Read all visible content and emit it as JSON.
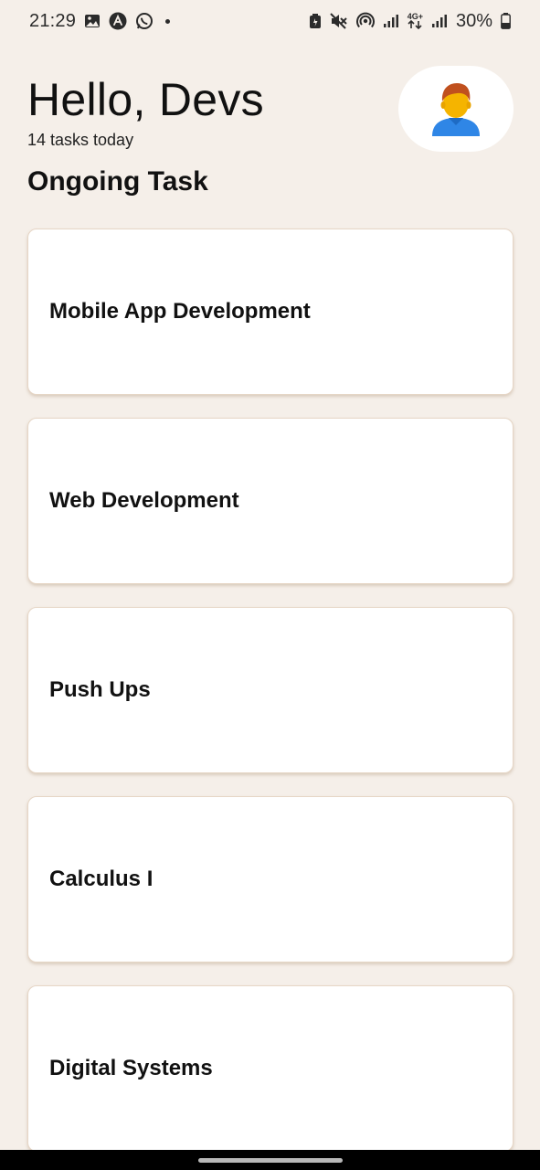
{
  "status_bar": {
    "time": "21:29",
    "battery_percent": "30%",
    "network_label": "4G+",
    "left_icons": [
      "gallery-icon",
      "app-notification-icon",
      "whatsapp-icon"
    ],
    "right_icons": [
      "battery-saver-icon",
      "mute-icon",
      "hotspot-icon",
      "signal-icon",
      "data-icon",
      "signal-icon",
      "battery-icon"
    ]
  },
  "header": {
    "greeting": "Hello, Devs",
    "subtitle": "14 tasks today",
    "avatar_icon": "user-avatar-icon"
  },
  "section": {
    "title": "Ongoing Task"
  },
  "tasks": [
    {
      "title": "Mobile App Development"
    },
    {
      "title": "Web Development"
    },
    {
      "title": "Push Ups"
    },
    {
      "title": "Calculus I"
    },
    {
      "title": "Digital Systems"
    }
  ],
  "colors": {
    "background": "#f5efe9",
    "card": "#ffffff",
    "card_border": "#e6d6c6",
    "avatar_hair": "#c0501e",
    "avatar_skin": "#f5b400",
    "avatar_shirt": "#2f86e6"
  }
}
